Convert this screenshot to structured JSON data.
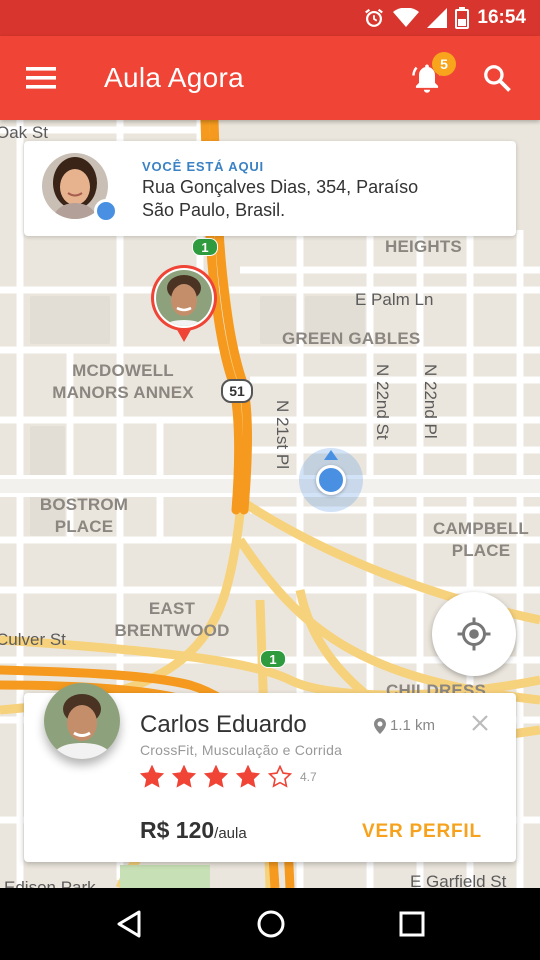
{
  "status_bar": {
    "time": "16:54"
  },
  "app_bar": {
    "title": "Aula Agora",
    "notification_count": "5"
  },
  "location_card": {
    "heading": "VOCÊ ESTÁ AQUI",
    "address_line1": "Rua Gonçalves Dias, 354, Paraíso",
    "address_line2": "São Paulo, Brasil."
  },
  "map": {
    "streets": [
      "Oak St",
      "E Palm Ln",
      "N 21st Pl",
      "N 22nd St",
      "N 22nd Pl",
      "Culver St",
      "E Garfield St",
      "Edison Park"
    ],
    "areas": [
      "HEIGHTS",
      "GREEN GABLES",
      "MCDOWELL MANORS ANNEX",
      "BOSTROM PLACE",
      "CAMPBELL PLACE",
      "EAST BRENTWOOD",
      "CHILDRESS"
    ],
    "route_shields": [
      "1",
      "51",
      "1"
    ]
  },
  "profile_card": {
    "name": "Carlos Eduardo",
    "distance": "1.1 km",
    "skills": "CrossFit, Musculação e Corrida",
    "rating": "4.7",
    "stars_filled": 4,
    "stars_total": 5,
    "price": "R$ 120",
    "price_unit": "/aula",
    "cta": "VER PERFIL"
  },
  "colors": {
    "primary": "#ef4436",
    "status": "#d7352d",
    "accent": "#f6a21d",
    "badge": "#f8a41c",
    "location_blue": "#4a90e2"
  }
}
